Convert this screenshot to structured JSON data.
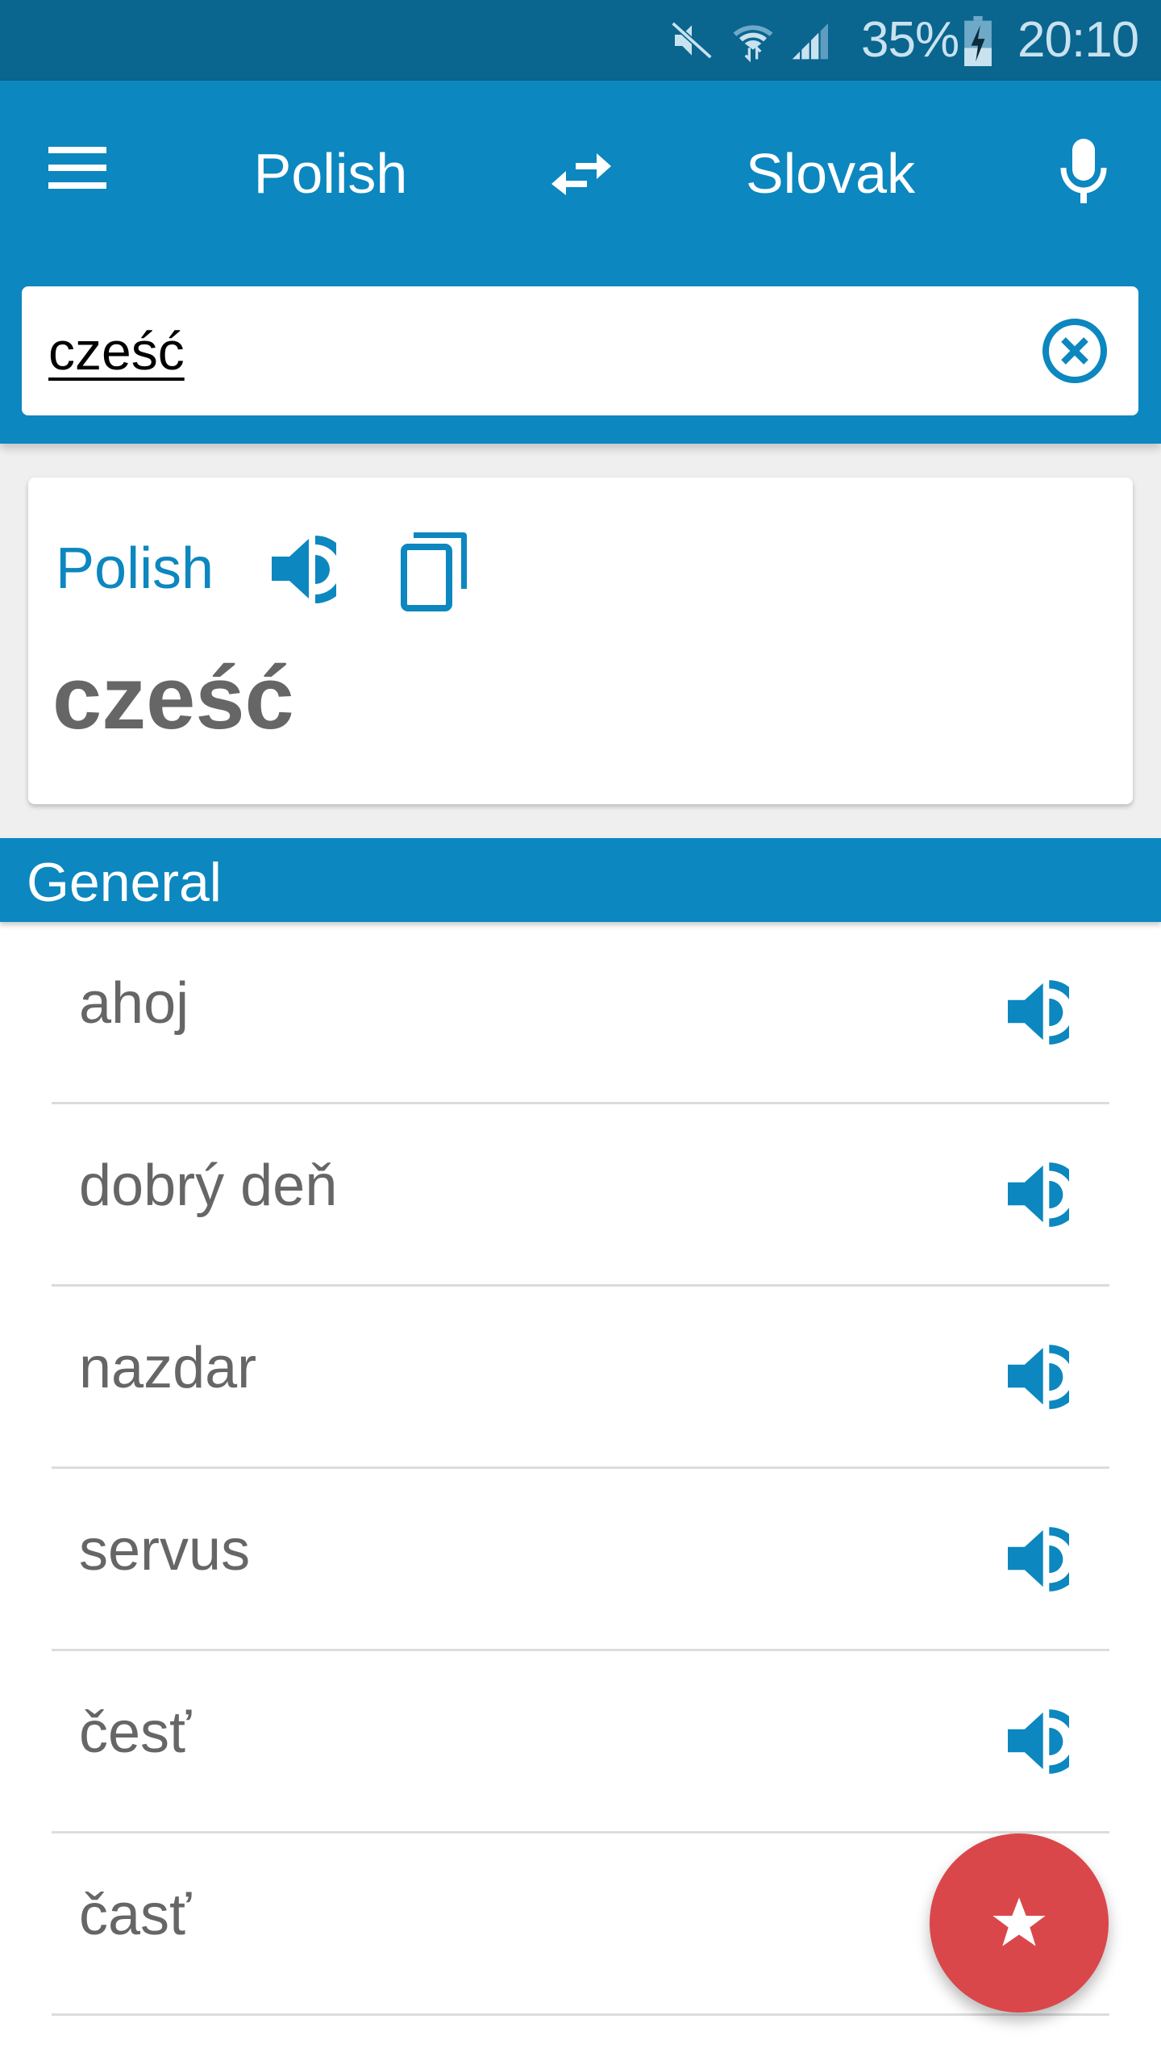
{
  "status_bar": {
    "icons": [
      "mute-icon",
      "wifi-icon",
      "signal-icon",
      "battery-charging-icon"
    ],
    "battery_percent": "35%",
    "time": "20:10"
  },
  "app_bar": {
    "menu_icon": "menu-icon",
    "source_language": "Polish",
    "swap_icon": "swap-icon",
    "target_language": "Slovak",
    "mic_icon": "mic-icon"
  },
  "search": {
    "value": "cześć",
    "clear_icon": "clear-circle-icon"
  },
  "source_card": {
    "language": "Polish",
    "speak_icon": "speaker-icon",
    "copy_icon": "copy-icon",
    "word": "cześć"
  },
  "section": {
    "title": "General"
  },
  "results": [
    {
      "text": "ahoj",
      "has_audio": true
    },
    {
      "text": "dobrý deň",
      "has_audio": true
    },
    {
      "text": "nazdar",
      "has_audio": true
    },
    {
      "text": "servus",
      "has_audio": true
    },
    {
      "text": "česť",
      "has_audio": true
    },
    {
      "text": "časť",
      "has_audio": false
    }
  ],
  "fab": {
    "icon": "star-icon",
    "label": "Favorite"
  },
  "colors": {
    "status_bar": "#0a658f",
    "primary": "#0c87bf",
    "fab": "#da474b",
    "result_text": "#666666"
  }
}
